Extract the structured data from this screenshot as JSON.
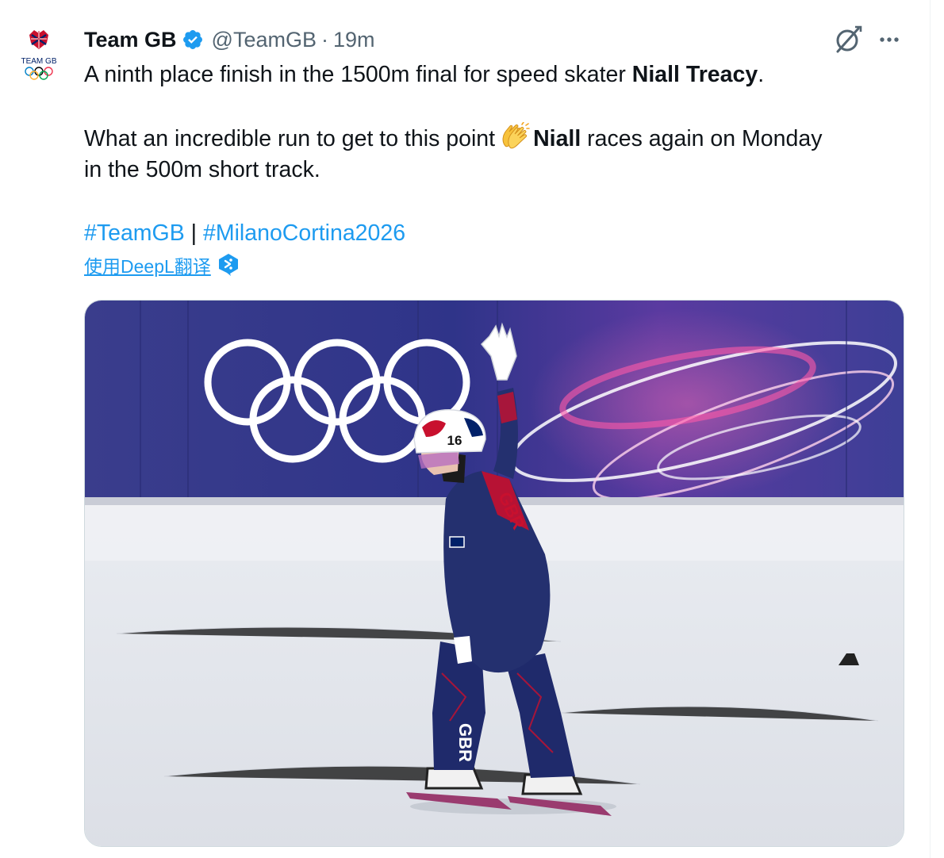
{
  "tweet": {
    "display_name": "Team GB",
    "handle": "@TeamGB",
    "separator": "·",
    "timestamp": "19m",
    "line1_prefix": "A ninth place finish in the 1500m final for speed skater ",
    "line1_bold": "Niall Treacy",
    "line1_suffix": ".",
    "line2_prefix": "What an incredible run to get to this point",
    "line2_bold": "Niall",
    "line2_suffix": " races again on Monday",
    "line3": "in the 500m short track.",
    "hashtag1": "#TeamGB",
    "hashtag_separator": " | ",
    "hashtag2": "#MilanoCortina2026",
    "translate_label": "使用DeepL翻译"
  },
  "avatar": {
    "logo_text": "TEAM GB"
  },
  "media": {
    "alt": "Speed skater wearing number 16 helmet waving on the ice with Olympic rings behind",
    "helmet_number": "16",
    "suit_text": "GBR"
  },
  "icons": {
    "verified": "verified-badge-icon",
    "grok": "grok-icon",
    "more": "more-options-icon",
    "clap": "clapping-hands-emoji",
    "deepl": "deepl-icon"
  },
  "colors": {
    "link": "#1d9bf0",
    "secondary_text": "#536471",
    "primary_text": "#0f1419"
  }
}
